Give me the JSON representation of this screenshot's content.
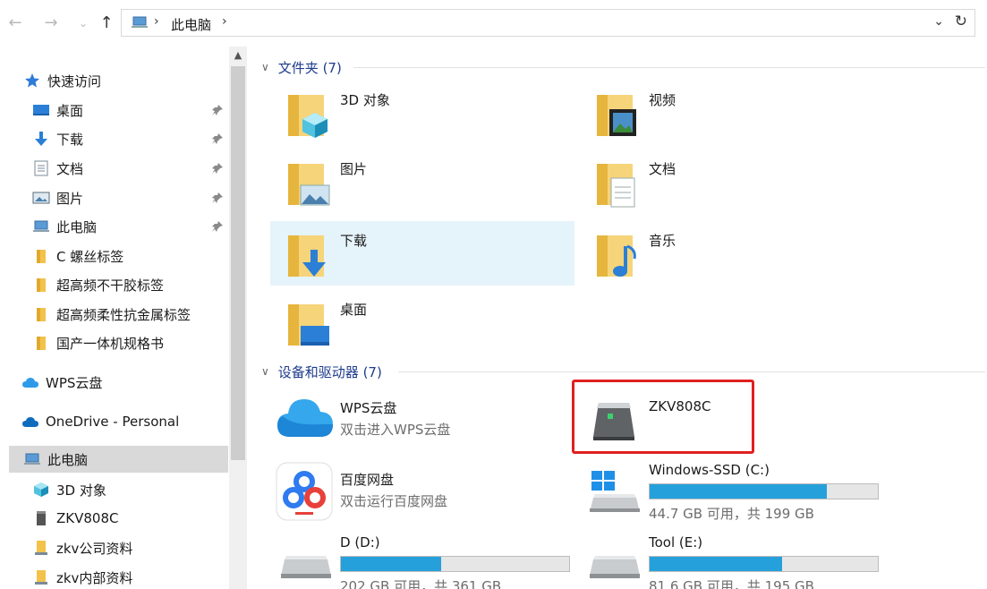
{
  "address": {
    "path": "此电脑",
    "back_icon": "back-arrow-icon",
    "forward_icon": "forward-arrow-icon"
  },
  "sidebar": {
    "quick_access": "快速访问",
    "pinned": [
      {
        "label": "桌面",
        "icon": "desktop-icon"
      },
      {
        "label": "下载",
        "icon": "download-icon"
      },
      {
        "label": "文档",
        "icon": "document-icon"
      },
      {
        "label": "图片",
        "icon": "picture-icon"
      },
      {
        "label": "此电脑",
        "icon": "computer-icon"
      }
    ],
    "folders": [
      "C 螺丝标签",
      "超高频不干胶标签",
      "超高频柔性抗金属标签",
      "国产一体机规格书"
    ],
    "wps": "WPS云盘",
    "onedrive": "OneDrive - Personal",
    "this_pc": "此电脑",
    "pc_children": [
      "3D 对象",
      "ZKV808C",
      "zkv公司资料",
      "zkv内部资料"
    ]
  },
  "content": {
    "folders_header": "文件夹 (7)",
    "folders": [
      "3D 对象",
      "视频",
      "图片",
      "文档",
      "下载",
      "音乐",
      "桌面"
    ],
    "devices_header": "设备和驱动器 (7)",
    "wps": {
      "name": "WPS云盘",
      "sub": "双击进入WPS云盘"
    },
    "zkv": {
      "name": "ZKV808C"
    },
    "baidu": {
      "name": "百度网盘",
      "sub": "双击运行百度网盘"
    },
    "drives": [
      {
        "name": "Windows-SSD (C:)",
        "sub": "44.7 GB 可用，共 199 GB",
        "used_fraction": 0.775
      },
      {
        "name": "D (D:)",
        "sub": "202 GB 可用，共 361 GB",
        "used_fraction": 0.44
      },
      {
        "name": "Tool (E:)",
        "sub": "81.6 GB 可用，共 195 GB",
        "used_fraction": 0.58
      }
    ]
  },
  "colors": {
    "accent": "#26a0da",
    "highlight": "#e5f3fb",
    "header": "#1e3c8c",
    "annotation": "#e02020"
  }
}
